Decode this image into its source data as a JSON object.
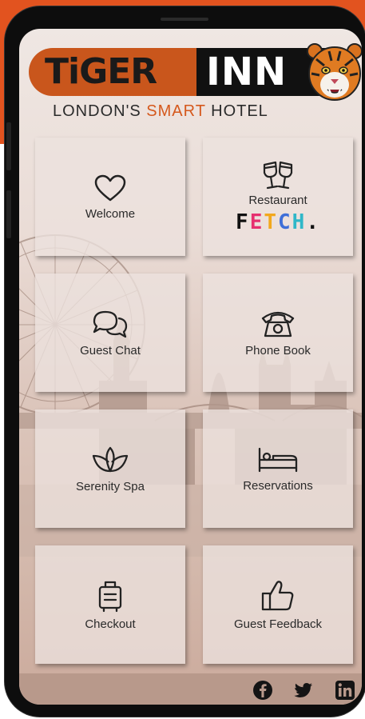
{
  "brand": {
    "name_left": "TiGER",
    "name_right": "INN",
    "tagline_part1": "LONDON'S ",
    "tagline_accent": "SMART",
    "tagline_part2": " HOTEL",
    "accent_color": "#d5581c"
  },
  "tiles": [
    {
      "label": "Welcome",
      "icon": "heart-icon"
    },
    {
      "label": "Restaurant",
      "icon": "champagne-glasses-icon",
      "sub_brand": [
        "F",
        "E",
        "T",
        "C",
        "H",
        "."
      ]
    },
    {
      "label": "Guest Chat",
      "icon": "chat-bubbles-icon"
    },
    {
      "label": "Phone Book",
      "icon": "telephone-icon"
    },
    {
      "label": "Serenity Spa",
      "icon": "lotus-icon"
    },
    {
      "label": "Reservations",
      "icon": "bed-icon"
    },
    {
      "label": "Checkout",
      "icon": "luggage-icon"
    },
    {
      "label": "Guest Feedback",
      "icon": "thumbs-up-icon"
    }
  ],
  "footer": {
    "social": [
      "facebook-icon",
      "twitter-icon",
      "linkedin-icon"
    ]
  }
}
